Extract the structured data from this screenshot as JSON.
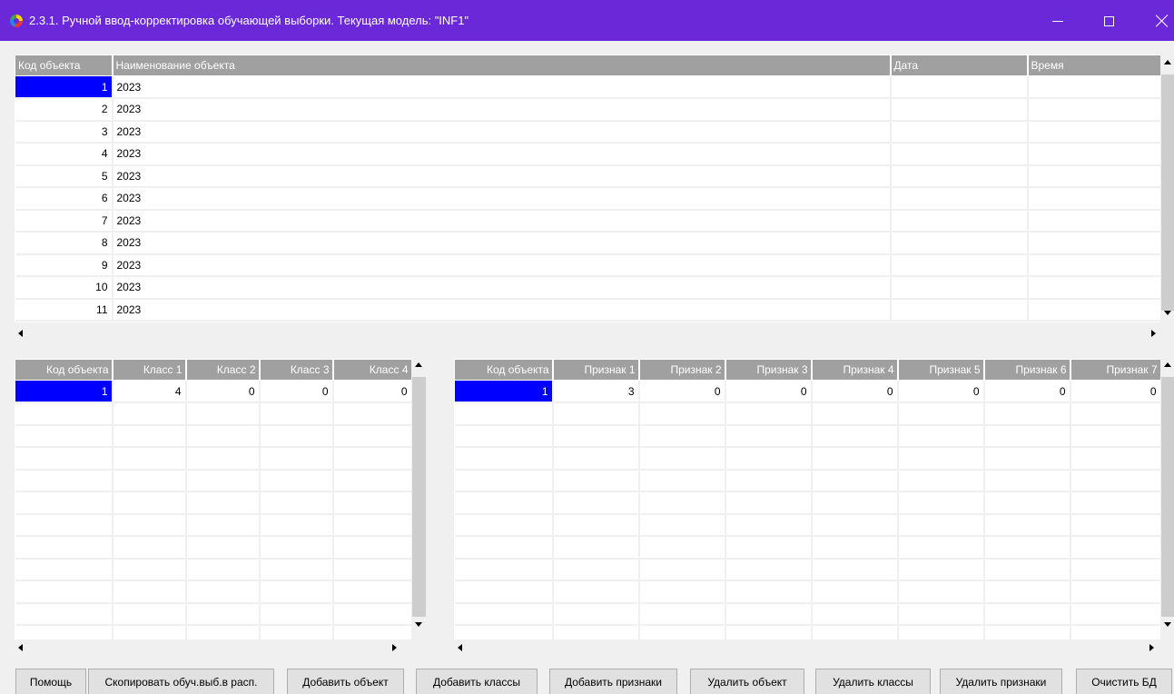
{
  "window": {
    "title": "2.3.1. Ручной ввод-корректировка обучающей выборки. Текущая модель: \"INF1\""
  },
  "objects_grid": {
    "columns": [
      "Код объекта",
      "Наименование объекта",
      "Дата",
      "Время"
    ],
    "rows": [
      {
        "code": "1",
        "name": "2023"
      },
      {
        "code": "2",
        "name": "2023"
      },
      {
        "code": "3",
        "name": "2023"
      },
      {
        "code": "4",
        "name": "2023"
      },
      {
        "code": "5",
        "name": "2023"
      },
      {
        "code": "6",
        "name": "2023"
      },
      {
        "code": "7",
        "name": "2023"
      },
      {
        "code": "8",
        "name": "2023"
      },
      {
        "code": "9",
        "name": "2023"
      },
      {
        "code": "10",
        "name": "2023"
      },
      {
        "code": "11",
        "name": "2023"
      }
    ]
  },
  "classes_grid": {
    "columns": [
      "Код объекта",
      "Класс 1",
      "Класс 2",
      "Класс 3",
      "Класс 4"
    ],
    "rows": [
      [
        "1",
        "4",
        "0",
        "0",
        "0"
      ]
    ]
  },
  "features_grid": {
    "columns": [
      "Код объекта",
      "Признак 1",
      "Признак 2",
      "Признак 3",
      "Признак 4",
      "Признак 5",
      "Признак 6",
      "Признак 7"
    ],
    "rows": [
      [
        "1",
        "3",
        "0",
        "0",
        "0",
        "0",
        "0",
        "0"
      ]
    ]
  },
  "buttons": {
    "help": "Помощь",
    "copy": "Скопировать обуч.выб.в расп.",
    "add_object": "Добавить объект",
    "add_classes": "Добавить классы",
    "add_features": "Добавить признаки",
    "delete_object": "Удалить объект",
    "delete_classes": "Удалить классы",
    "delete_features": "Удалить признаки",
    "clear_db": "Очистить БД"
  },
  "colors": {
    "titlebar": "#6a28d9",
    "header": "#a0a0a0",
    "selection": "#0000ff"
  }
}
